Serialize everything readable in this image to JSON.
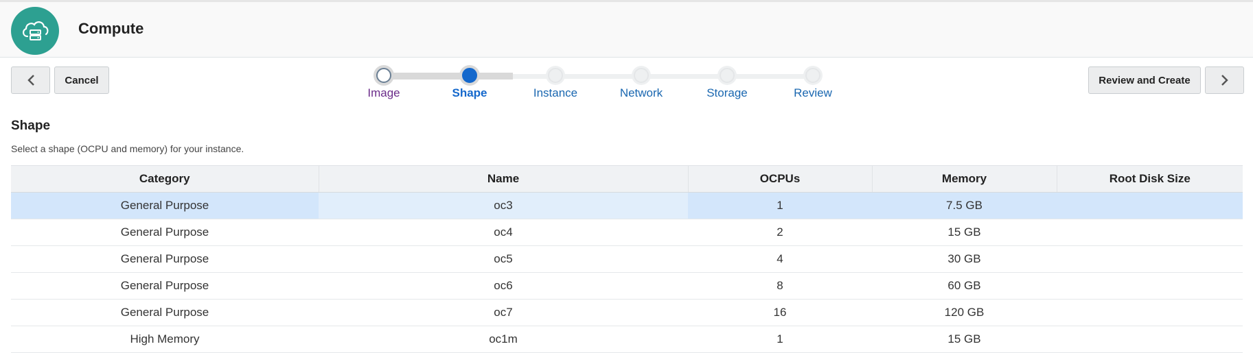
{
  "header": {
    "title": "Compute",
    "logo_icon": "cloud-server-icon",
    "logo_color": "#2da091"
  },
  "nav": {
    "back_icon": "chevron-left-icon",
    "cancel_label": "Cancel",
    "review_label": "Review and Create",
    "next_icon": "chevron-right-icon"
  },
  "train": {
    "current": "Shape",
    "steps": [
      {
        "label": "Image",
        "state": "visited"
      },
      {
        "label": "Shape",
        "state": "current"
      },
      {
        "label": "Instance",
        "state": "future"
      },
      {
        "label": "Network",
        "state": "future"
      },
      {
        "label": "Storage",
        "state": "future"
      },
      {
        "label": "Review",
        "state": "future"
      }
    ]
  },
  "section": {
    "title": "Shape",
    "description": "Select a shape (OCPU and memory) for your instance."
  },
  "table": {
    "columns": [
      "Category",
      "Name",
      "OCPUs",
      "Memory",
      "Root Disk Size"
    ],
    "selected_row": 0,
    "rows": [
      [
        "General Purpose",
        "oc3",
        "1",
        "7.5 GB",
        ""
      ],
      [
        "General Purpose",
        "oc4",
        "2",
        "15 GB",
        ""
      ],
      [
        "General Purpose",
        "oc5",
        "4",
        "30 GB",
        ""
      ],
      [
        "General Purpose",
        "oc6",
        "8",
        "60 GB",
        ""
      ],
      [
        "General Purpose",
        "oc7",
        "16",
        "120 GB",
        ""
      ],
      [
        "High Memory",
        "oc1m",
        "1",
        "15 GB",
        ""
      ]
    ]
  },
  "colors": {
    "accent": "#1468cc",
    "selected_row": "#d3e6fb",
    "visited_link": "#6b2c8a"
  }
}
